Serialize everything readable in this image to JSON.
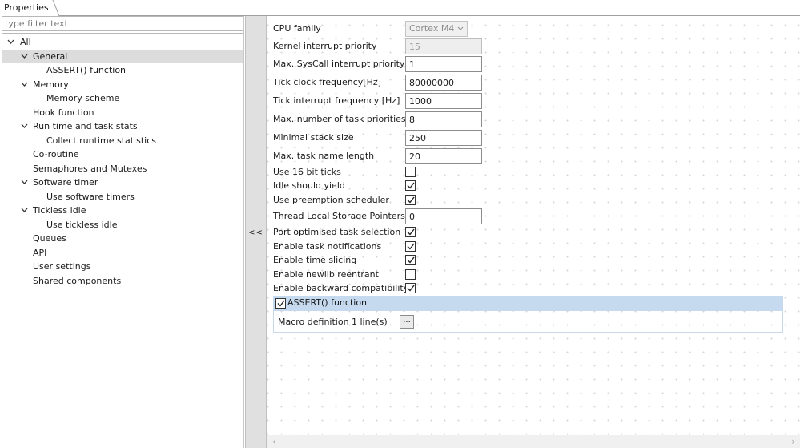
{
  "tab": {
    "title": "Properties"
  },
  "filter": {
    "placeholder": "type filter text"
  },
  "tree": {
    "all": "All",
    "general": "General",
    "assert_function": "ASSERT() function",
    "memory": "Memory",
    "memory_scheme": "Memory scheme",
    "hook_function": "Hook function",
    "run_time_stats": "Run time and task stats",
    "collect_runtime": "Collect runtime statistics",
    "co_routine": "Co-routine",
    "semaphores": "Semaphores and Mutexes",
    "software_timer": "Software timer",
    "use_software_timers": "Use software timers",
    "tickless_idle": "Tickless idle",
    "use_tickless_idle": "Use tickless idle",
    "queues": "Queues",
    "api": "API",
    "user_settings": "User settings",
    "shared_components": "Shared components",
    "selected": "General"
  },
  "splitter": {
    "collapse_label": "<<"
  },
  "properties": {
    "cpu_family": {
      "label": "CPU family",
      "value": "Cortex M4"
    },
    "kernel_irq_priority": {
      "label": "Kernel interrupt priority",
      "value": "15"
    },
    "max_syscall_irq_priority": {
      "label": "Max. SysCall interrupt priority",
      "value": "1"
    },
    "tick_clock_freq": {
      "label": "Tick clock frequency[Hz]",
      "value": "80000000"
    },
    "tick_irq_freq": {
      "label": "Tick interrupt frequency [Hz]",
      "value": "1000"
    },
    "max_task_priorities": {
      "label": "Max. number of task priorities",
      "value": "8"
    },
    "min_stack_size": {
      "label": "Minimal stack size",
      "value": "250"
    },
    "max_task_name_length": {
      "label": "Max. task name length",
      "value": "20"
    },
    "use_16bit_ticks": {
      "label": "Use 16 bit ticks",
      "checked": false
    },
    "idle_should_yield": {
      "label": "Idle should yield",
      "checked": true
    },
    "use_preemption": {
      "label": "Use preemption scheduler",
      "checked": true
    },
    "tls_pointers": {
      "label": "Thread Local Storage Pointers",
      "value": "0"
    },
    "port_optimised": {
      "label": "Port optimised task selection",
      "checked": true
    },
    "task_notifications": {
      "label": "Enable task notifications",
      "checked": true
    },
    "time_slicing": {
      "label": "Enable time slicing",
      "checked": true
    },
    "newlib_reentrant": {
      "label": "Enable newlib reentrant",
      "checked": false
    },
    "backward_compat": {
      "label": "Enable backward compatibility",
      "checked": true
    }
  },
  "assert_section": {
    "title": "ASSERT() function",
    "checked": true,
    "macro_label": "Macro definition",
    "macro_value": "1 line(s)",
    "edit_button": "..."
  },
  "colors": {
    "selection_bg": "#dcdcdc",
    "section_header_bg": "#c5d9ef",
    "splitter_bg": "#e0e0e0"
  }
}
